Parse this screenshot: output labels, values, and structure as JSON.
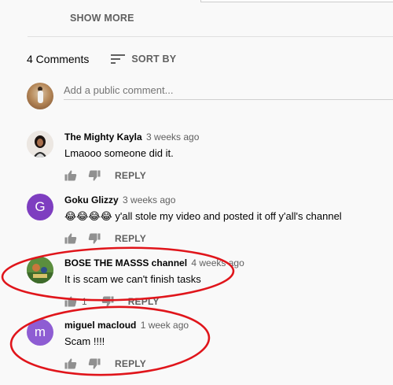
{
  "show_more_label": "SHOW MORE",
  "comments_header": {
    "count_label": "4 Comments",
    "sort_label": "SORT BY"
  },
  "add_comment": {
    "placeholder": "Add a public comment..."
  },
  "reply_label": "REPLY",
  "comments": [
    {
      "author": "The Mighty Kayla",
      "time": "3 weeks ago",
      "text": "Lmaooo someone did it.",
      "likes": "",
      "avatar_letter": ""
    },
    {
      "author": "Goku Glizzy",
      "time": "3 weeks ago",
      "text": "😂😂😂😂 y'all stole my video and posted it off y'all's channel",
      "likes": "",
      "avatar_letter": "G",
      "avatar_color": "#7e3ec0"
    },
    {
      "author": "BOSE THE MASSS channel",
      "time": "4 weeks ago",
      "text": "It is scam we can't finish tasks",
      "likes": "1",
      "avatar_letter": ""
    },
    {
      "author": "miguel macloud",
      "time": "1 week ago",
      "text": "Scam !!!!",
      "likes": "",
      "avatar_letter": "m",
      "avatar_color": "#8e5dd3"
    }
  ],
  "annotation_color": "#e0151b"
}
